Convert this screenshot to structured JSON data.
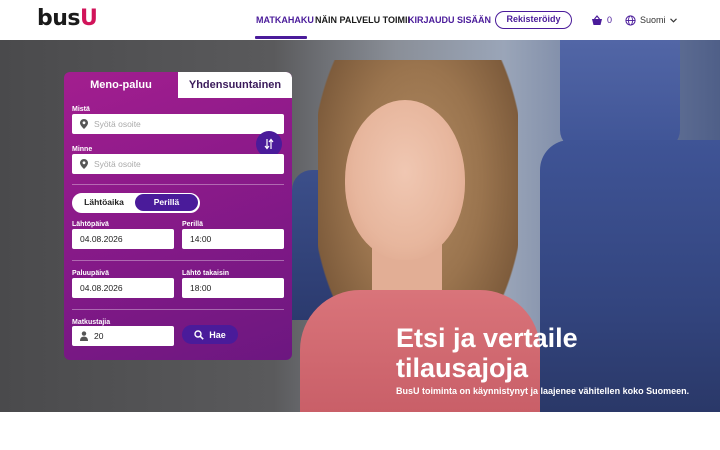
{
  "header": {
    "logo_main": "bus",
    "logo_accent": "U",
    "nav": {
      "matkahaku": "MATKAHAKU",
      "palvelu": "NÄIN PALVELU TOIMII",
      "login": "KIRJAUDU SISÄÄN"
    },
    "register_label": "Rekisteröidy",
    "cart_count": "0",
    "language": "Suomi"
  },
  "search": {
    "tabs": [
      "Meno-paluu",
      "Yhdensuuntainen"
    ],
    "from_label": "Mistä",
    "from_placeholder": "Syötä osoite",
    "to_label": "Minne",
    "to_placeholder": "Syötä osoite",
    "time_toggle": [
      "Lähtöaika",
      "Perillä"
    ],
    "departure_date_label": "Lähtöpäivä",
    "departure_date": "04.08.2026",
    "arrival_label": "Perillä",
    "arrival_time": "14:00",
    "return_date_label": "Paluupäivä",
    "return_date": "04.08.2026",
    "return_time_label": "Lähtö takaisin",
    "return_time": "18:00",
    "passengers_label": "Matkustajia",
    "passengers": "20",
    "search_button": "Hae"
  },
  "hero": {
    "title": "Etsi ja vertaile tilausajoja",
    "subtitle": "BusU toiminta on käynnistynyt ja laajenee vähitellen koko Suomeen."
  },
  "colors": {
    "brand_purple": "#4a1b9a",
    "brand_magenta": "#a31e8f",
    "logo_accent": "#d1145a"
  }
}
